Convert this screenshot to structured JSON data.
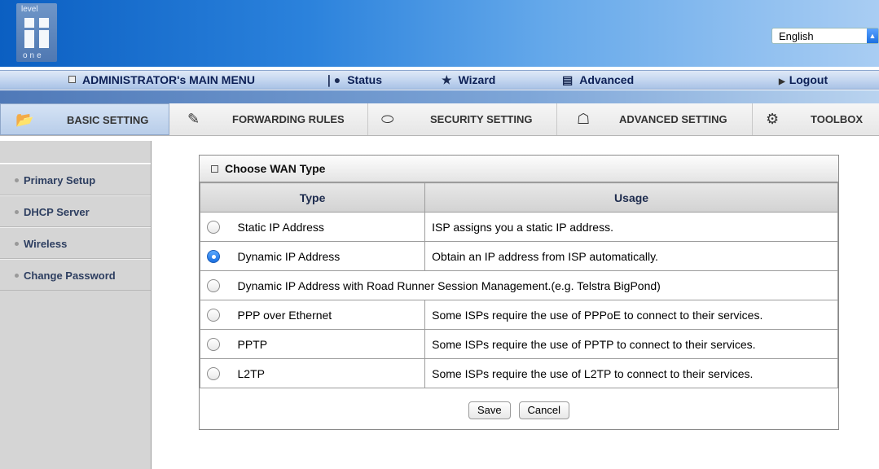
{
  "brand": {
    "logo_top": "level",
    "logo_bottom": "one"
  },
  "language": {
    "selected": "English"
  },
  "main_menu": {
    "admin": "ADMINISTRATOR's MAIN MENU",
    "status": "Status",
    "wizard": "Wizard",
    "advanced": "Advanced",
    "logout": "Logout"
  },
  "tabs": [
    {
      "label": "BASIC SETTING",
      "icon": "folder-icon"
    },
    {
      "label": "FORWARDING RULES",
      "icon": "forwarding-icon"
    },
    {
      "label": "SECURITY SETTING",
      "icon": "security-icon"
    },
    {
      "label": "ADVANCED SETTING",
      "icon": "advanced-icon"
    },
    {
      "label": "TOOLBOX",
      "icon": "toolbox-icon"
    }
  ],
  "sidebar": {
    "items": [
      {
        "label": "Primary Setup"
      },
      {
        "label": "DHCP Server"
      },
      {
        "label": "Wireless"
      },
      {
        "label": "Change Password"
      }
    ]
  },
  "wan": {
    "title": "Choose WAN Type",
    "col_type": "Type",
    "col_usage": "Usage",
    "rows": [
      {
        "type": "Static IP Address",
        "usage": "ISP assigns you a static IP address.",
        "selected": false
      },
      {
        "type": "Dynamic IP Address",
        "usage": "Obtain an IP address from ISP automatically.",
        "selected": true
      },
      {
        "type": "Dynamic IP Address with Road Runner Session Management.(e.g. Telstra BigPond)",
        "usage": "",
        "selected": false
      },
      {
        "type": "PPP over Ethernet",
        "usage": "Some ISPs require the use of PPPoE to connect to their services.",
        "selected": false
      },
      {
        "type": "PPTP",
        "usage": "Some ISPs require the use of PPTP to connect to their services.",
        "selected": false
      },
      {
        "type": "L2TP",
        "usage": "Some ISPs require the use of L2TP to connect to their services.",
        "selected": false
      }
    ],
    "save_label": "Save",
    "cancel_label": "Cancel"
  }
}
